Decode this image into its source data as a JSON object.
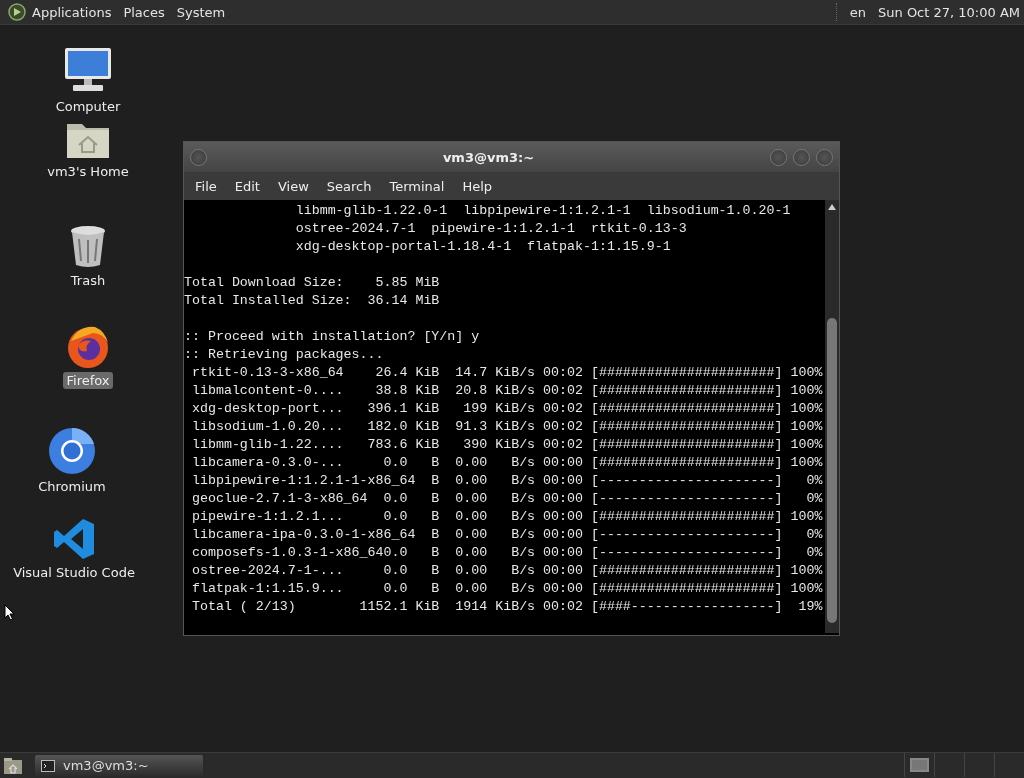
{
  "top_panel": {
    "menus": [
      "Applications",
      "Places",
      "System"
    ],
    "keyboard_layout": "en",
    "clock": "Sun Oct 27, 10:00 AM"
  },
  "desktop_icons": [
    {
      "label": "Computer",
      "kind": "computer",
      "selected": false
    },
    {
      "label": "vm3's Home",
      "kind": "home",
      "selected": false
    },
    {
      "label": "Trash",
      "kind": "trash",
      "selected": false
    },
    {
      "label": "Firefox",
      "kind": "firefox",
      "selected": true
    },
    {
      "label": "Chromium",
      "kind": "chromium",
      "selected": false
    },
    {
      "label": "Visual Studio Code",
      "kind": "vscode",
      "selected": false
    }
  ],
  "terminal_window": {
    "title": "vm3@vm3:~",
    "menus": [
      "File",
      "Edit",
      "View",
      "Search",
      "Terminal",
      "Help"
    ],
    "blocks": [
      [
        "              libmm-glib-1.22.0-1  libpipewire-1:1.2.1-1  libsodium-1.0.20-1",
        "              ostree-2024.7-1  pipewire-1:1.2.1-1  rtkit-0.13-3",
        "              xdg-desktop-portal-1.18.4-1  flatpak-1:1.15.9-1"
      ],
      [
        "Total Download Size:    5.85 MiB",
        "Total Installed Size:  36.14 MiB"
      ],
      [
        ":: Proceed with installation? [Y/n] y",
        ":: Retrieving packages...",
        " rtkit-0.13-3-x86_64    26.4 KiB  14.7 KiB/s 00:02 [######################] 100%",
        " libmalcontent-0....    38.8 KiB  20.8 KiB/s 00:02 [######################] 100%",
        " xdg-desktop-port...   396.1 KiB   199 KiB/s 00:02 [######################] 100%",
        " libsodium-1.0.20...   182.0 KiB  91.3 KiB/s 00:02 [######################] 100%",
        " libmm-glib-1.22....   783.6 KiB   390 KiB/s 00:02 [######################] 100%",
        " libcamera-0.3.0-...     0.0   B  0.00   B/s 00:00 [######################] 100%",
        " libpipewire-1:1.2.1-1-x86_64  B  0.00   B/s 00:00 [----------------------]   0%",
        " geoclue-2.7.1-3-x86_64  0.0   B  0.00   B/s 00:00 [----------------------]   0%",
        " pipewire-1:1.2.1...     0.0   B  0.00   B/s 00:00 [######################] 100%",
        " libcamera-ipa-0.3.0-1-x86_64  B  0.00   B/s 00:00 [----------------------]   0%",
        " composefs-1.0.3-1-x86_640.0   B  0.00   B/s 00:00 [----------------------]   0%",
        " ostree-2024.7-1-...     0.0   B  0.00   B/s 00:00 [######################] 100%",
        " flatpak-1:1.15.9...     0.0   B  0.00   B/s 00:00 [######################] 100%",
        " Total ( 2/13)        1152.1 KiB  1914 KiB/s 00:02 [####------------------]  19%"
      ]
    ]
  },
  "taskbar": {
    "tasks": [
      {
        "label": "vm3@vm3:~",
        "selected": true
      }
    ]
  }
}
